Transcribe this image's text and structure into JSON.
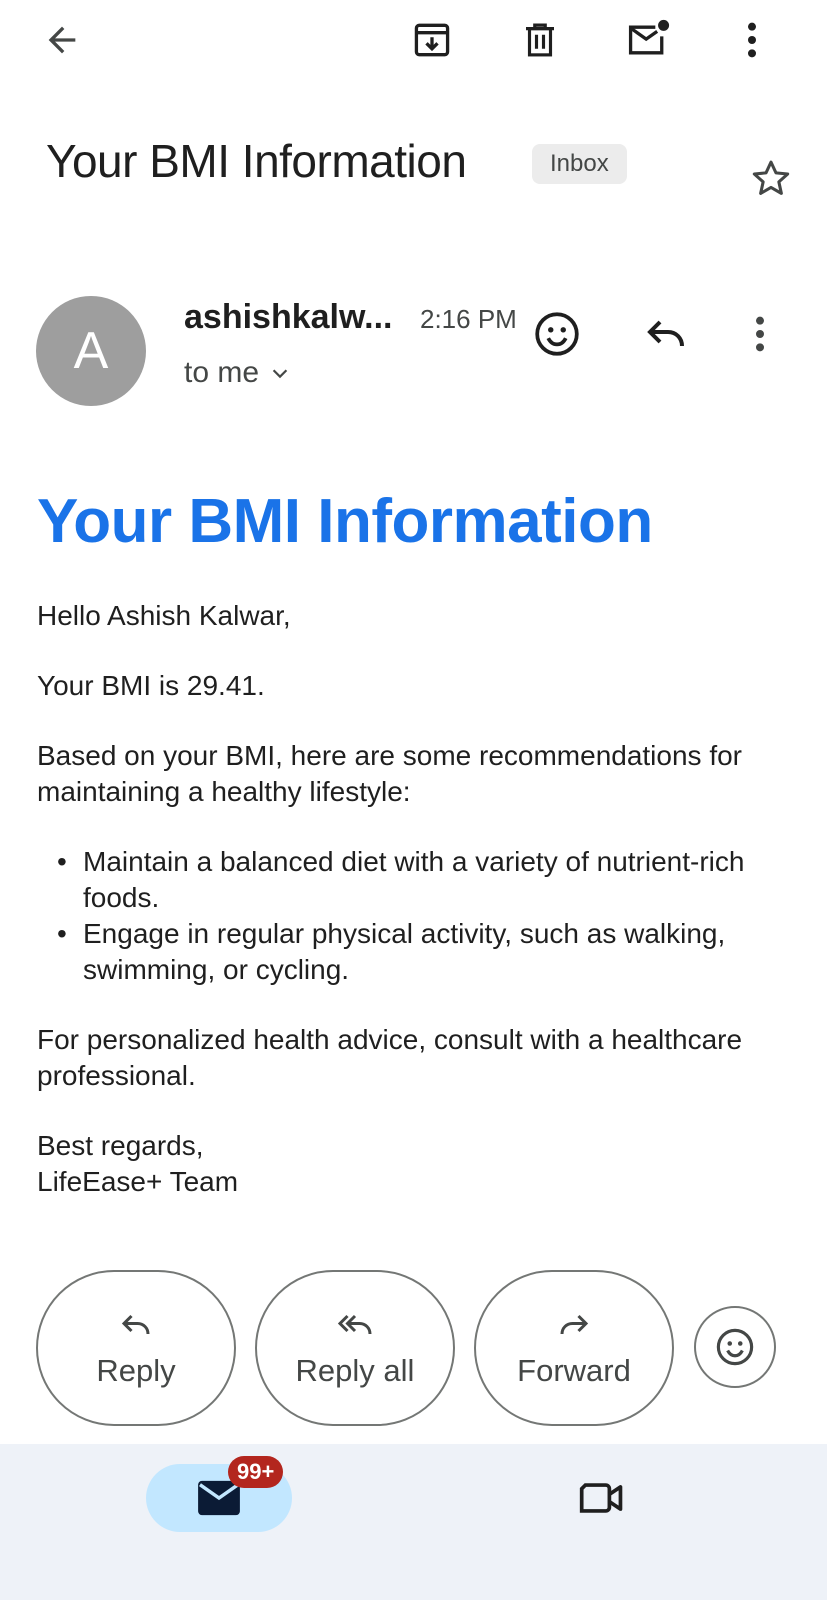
{
  "toolbar": {
    "back_icon": "arrow-left-icon",
    "archive_icon": "archive-icon",
    "delete_icon": "trash-icon",
    "mark_unread_icon": "mail-unread-icon",
    "more_icon": "more-vertical-icon"
  },
  "email": {
    "subject": "Your BMI Information",
    "label": "Inbox",
    "star_icon": "star-outline-icon"
  },
  "sender": {
    "avatar_letter": "A",
    "avatar_color": "#9e9e9e",
    "name": "ashishkalw...",
    "time": "2:16 PM",
    "recipient": "to me",
    "emoji_icon": "emoji-icon",
    "reply_icon": "reply-icon",
    "more_icon": "more-vertical-icon"
  },
  "body": {
    "heading": "Your BMI Information",
    "heading_color": "#1a73e8",
    "greeting": "Hello Ashish Kalwar,",
    "bmi_line": "Your BMI is 29.41.",
    "intro": "Based on your BMI, here are some recommendations for maintaining a healthy lifestyle:",
    "recommendations": [
      "Maintain a balanced diet with a variety of nutrient-rich foods.",
      "Engage in regular physical activity, such as walking, swimming, or cycling."
    ],
    "advice": "For personalized health advice, consult with a healthcare professional.",
    "closing": "Best regards,",
    "signature": "LifeEase+ Team"
  },
  "actions": {
    "reply": "Reply",
    "reply_all": "Reply all",
    "forward": "Forward"
  },
  "bottom_nav": {
    "mail_badge": "99+",
    "mail_icon": "mail-icon",
    "meet_icon": "video-camera-icon",
    "badge_color": "#b3261e"
  }
}
